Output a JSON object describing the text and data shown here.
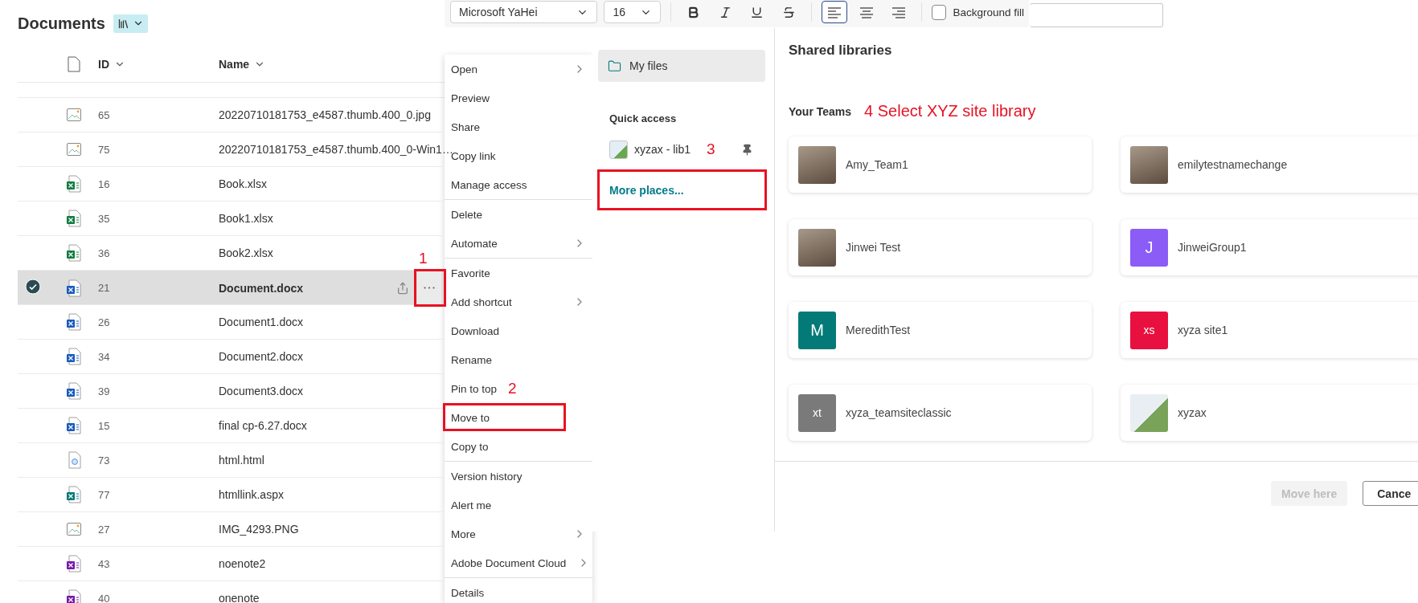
{
  "library": {
    "title": "Documents"
  },
  "table": {
    "columns": [
      {
        "kind": "icon"
      },
      {
        "kind": "text",
        "label": "ID"
      },
      {
        "kind": "text",
        "label": "Name"
      }
    ],
    "rows": [
      {
        "id": "65",
        "name": "20220710181753_e4587.thumb.400_0.jpg",
        "kind": "image",
        "selected": false
      },
      {
        "id": "75",
        "name": "20220710181753_e4587.thumb.400_0-Win1…",
        "kind": "image",
        "selected": false
      },
      {
        "id": "16",
        "name": "Book.xlsx",
        "kind": "sheet",
        "selected": false
      },
      {
        "id": "35",
        "name": "Book1.xlsx",
        "kind": "sheet",
        "selected": false
      },
      {
        "id": "36",
        "name": "Book2.xlsx",
        "kind": "sheet",
        "selected": false
      },
      {
        "id": "21",
        "name": "Document.docx",
        "kind": "doc",
        "selected": true,
        "more_button": {
          "highlighted": true,
          "annotation": "1"
        }
      },
      {
        "id": "26",
        "name": "Document1.docx",
        "kind": "doc",
        "selected": false
      },
      {
        "id": "34",
        "name": "Document2.docx",
        "kind": "doc",
        "selected": false
      },
      {
        "id": "39",
        "name": "Document3.docx",
        "kind": "doc",
        "selected": false
      },
      {
        "id": "15",
        "name": "final cp-6.27.docx",
        "kind": "doc",
        "selected": false
      },
      {
        "id": "73",
        "name": "html.html",
        "kind": "web",
        "selected": false
      },
      {
        "id": "77",
        "name": "htmllink.aspx",
        "kind": "page",
        "selected": false
      },
      {
        "id": "27",
        "name": "IMG_4293.PNG",
        "kind": "image",
        "selected": false
      },
      {
        "id": "43",
        "name": "noenote2",
        "kind": "notebook",
        "selected": false
      },
      {
        "id": "40",
        "name": "onenote",
        "kind": "notebook",
        "selected": false
      }
    ]
  },
  "toolbar": {
    "font": "Microsoft YaHei",
    "size": "16",
    "tools": [
      {
        "kind": "bold",
        "selected": false
      },
      {
        "kind": "italic",
        "selected": false
      },
      {
        "kind": "underline",
        "selected": false
      },
      {
        "kind": "strike",
        "selected": false
      },
      {
        "kind": "align_left",
        "selected": true
      },
      {
        "kind": "align_center",
        "selected": false
      },
      {
        "kind": "align_right",
        "selected": false
      }
    ],
    "background_fill": {
      "label": "Background fill",
      "checked": false
    }
  },
  "context_menu": {
    "groups": [
      [
        {
          "label": "Open",
          "submenu": true,
          "highlighted": false
        },
        {
          "label": "Preview",
          "submenu": false,
          "highlighted": false
        },
        {
          "label": "Share",
          "submenu": false,
          "highlighted": false
        },
        {
          "label": "Copy link",
          "submenu": false,
          "highlighted": false
        },
        {
          "label": "Manage access",
          "submenu": false,
          "highlighted": false
        }
      ],
      [
        {
          "label": "Delete",
          "submenu": false,
          "highlighted": false
        },
        {
          "label": "Automate",
          "submenu": true,
          "highlighted": false
        }
      ],
      [
        {
          "label": "Favorite",
          "submenu": false,
          "highlighted": false
        },
        {
          "label": "Add shortcut",
          "submenu": true,
          "highlighted": false
        },
        {
          "label": "Download",
          "submenu": false,
          "highlighted": false
        },
        {
          "label": "Rename",
          "submenu": false,
          "highlighted": false
        },
        {
          "label": "Pin to top",
          "submenu": false,
          "highlighted": false,
          "annotation": "2"
        },
        {
          "label": "Move to",
          "submenu": false,
          "highlighted": true
        },
        {
          "label": "Copy to",
          "submenu": false,
          "highlighted": false
        }
      ],
      [
        {
          "label": "Version history",
          "submenu": false,
          "highlighted": false
        },
        {
          "label": "Alert me",
          "submenu": false,
          "highlighted": false
        },
        {
          "label": "More",
          "submenu": true,
          "highlighted": false
        },
        {
          "label": "Adobe Document Cloud",
          "submenu": true,
          "highlighted": false
        }
      ],
      [
        {
          "label": "Details",
          "submenu": false,
          "highlighted": false
        }
      ]
    ]
  },
  "move_dialog": {
    "my_files": {
      "label": "My files",
      "selected": true
    },
    "quick_access": {
      "heading": "Quick access",
      "items": [
        {
          "label": "xyzax - lib1",
          "annotation": "3"
        }
      ]
    },
    "more_places": {
      "label": "More places...",
      "highlighted": true
    },
    "heading": "Shared libraries",
    "teams_section": {
      "heading": "Your Teams",
      "annotation": "4 Select XYZ site library",
      "teams": [
        {
          "name": "Amy_Team1",
          "avatar": {
            "kind": "photo"
          }
        },
        {
          "name": "emilytestnamechange",
          "avatar": {
            "kind": "photo"
          }
        },
        {
          "name": "Jinwei Test",
          "avatar": {
            "kind": "photo"
          }
        },
        {
          "name": "JinweiGroup1",
          "avatar": {
            "kind": "initials",
            "text": "J",
            "color": "#8c5cf6"
          }
        },
        {
          "name": "MeredithTest",
          "avatar": {
            "kind": "initials",
            "text": "M",
            "color": "#037a78"
          }
        },
        {
          "name": "xyza site1",
          "avatar": {
            "kind": "initials",
            "text": "xs",
            "color": "#e8103e"
          }
        },
        {
          "name": "xyza_teamsiteclassic",
          "avatar": {
            "kind": "initials",
            "text": "xt",
            "color": "#7a7a7a"
          }
        },
        {
          "name": "xyzax",
          "avatar": {
            "kind": "illustration"
          }
        }
      ]
    },
    "buttons": [
      {
        "label": "Move here",
        "disabled": true
      },
      {
        "label": "Cance",
        "disabled": false
      }
    ]
  }
}
